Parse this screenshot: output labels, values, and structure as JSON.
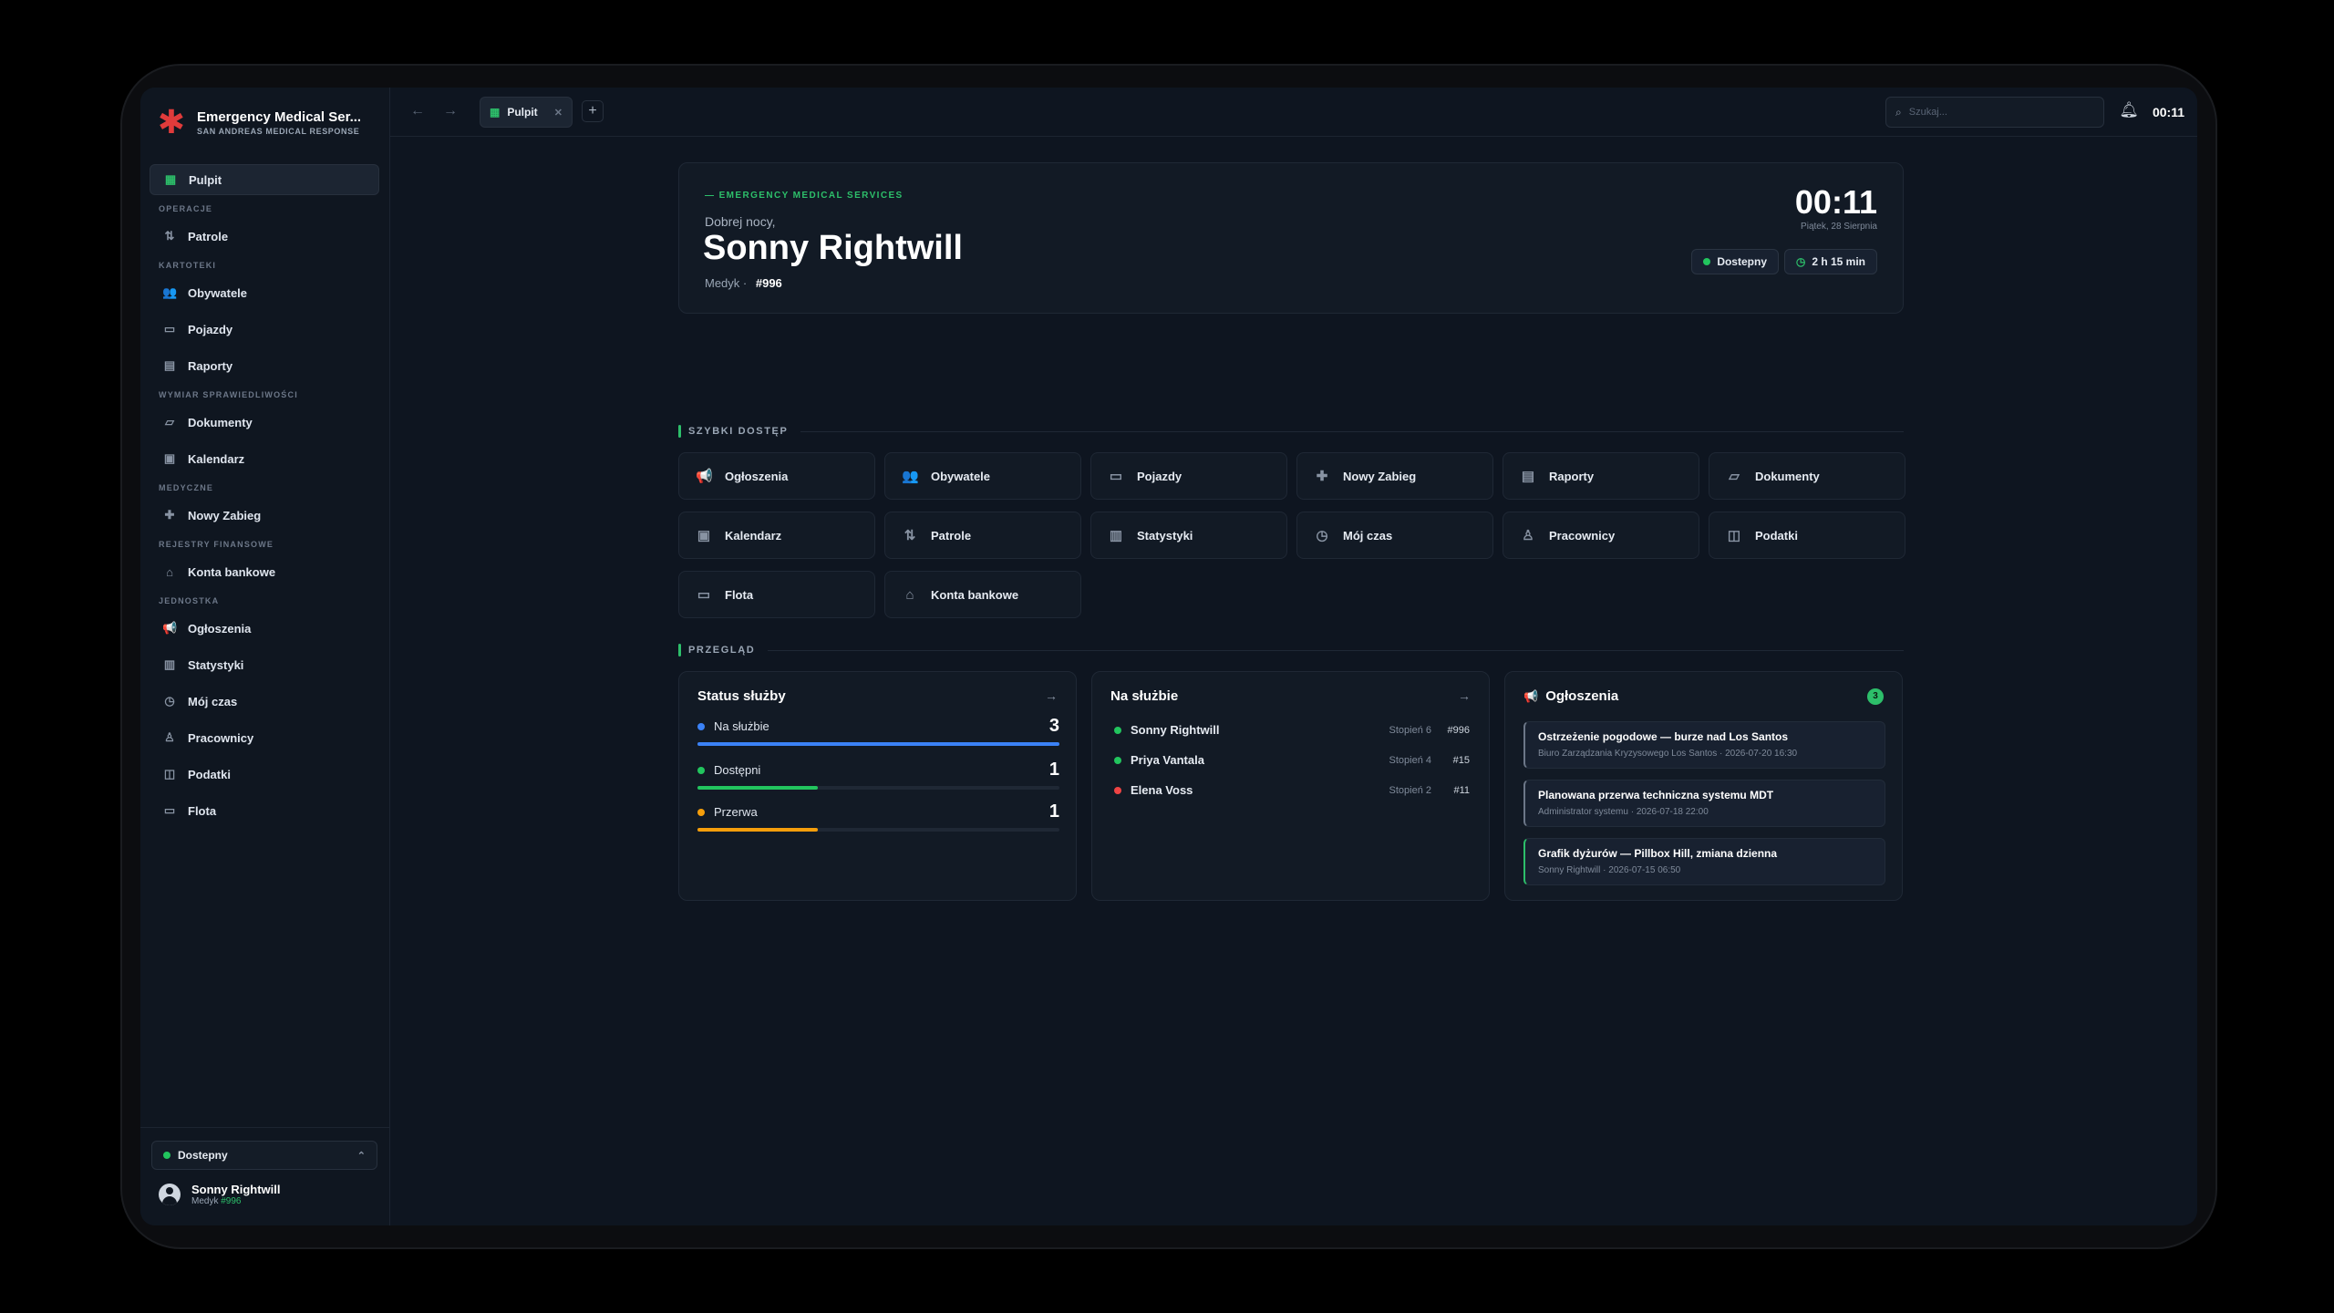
{
  "app": {
    "title": "Emergency Medical Ser...",
    "subtitle": "SAN ANDREAS MEDICAL RESPONSE"
  },
  "sidebar": {
    "active": {
      "label": "Pulpit",
      "icon": "grid-icon"
    },
    "sections": [
      {
        "title": "OPERACJE",
        "items": [
          {
            "label": "Patrole",
            "icon": "route-icon"
          }
        ]
      },
      {
        "title": "KARTOTEKI",
        "items": [
          {
            "label": "Obywatele",
            "icon": "users-icon"
          },
          {
            "label": "Pojazdy",
            "icon": "car-icon"
          },
          {
            "label": "Raporty",
            "icon": "file-icon"
          }
        ]
      },
      {
        "title": "WYMIAR SPRAWIEDLIWOŚCI",
        "items": [
          {
            "label": "Dokumenty",
            "icon": "folder-icon"
          },
          {
            "label": "Kalendarz",
            "icon": "calendar-icon"
          }
        ]
      },
      {
        "title": "MEDYCZNE",
        "items": [
          {
            "label": "Nowy Zabieg",
            "icon": "medkit-icon"
          }
        ]
      },
      {
        "title": "REJESTRY FINANSOWE",
        "items": [
          {
            "label": "Konta bankowe",
            "icon": "bank-icon"
          }
        ]
      },
      {
        "title": "JEDNOSTKA",
        "items": [
          {
            "label": "Ogłoszenia",
            "icon": "megaphone-icon"
          },
          {
            "label": "Statystyki",
            "icon": "chart-icon"
          },
          {
            "label": "Mój czas",
            "icon": "clock-icon"
          },
          {
            "label": "Pracownicy",
            "icon": "worker-icon"
          },
          {
            "label": "Podatki",
            "icon": "money-icon"
          },
          {
            "label": "Flota",
            "icon": "fleet-icon"
          }
        ]
      }
    ],
    "status_label": "Dostepny",
    "user": {
      "name": "Sonny Rightwill",
      "role": "Medyk",
      "badge": "#996"
    }
  },
  "topbar": {
    "tab_label": "Pulpit",
    "search_placeholder": "Szukaj...",
    "clock": "00:11"
  },
  "hero": {
    "tag": "EMERGENCY MEDICAL SERVICES",
    "greeting": "Dobrej nocy,",
    "name": "Sonny Rightwill",
    "role": "Medyk",
    "badge": "#996",
    "clock": "00:11",
    "date": "Piątek, 28 Sierpnia",
    "status": "Dostepny",
    "duration": "2 h 15 min"
  },
  "quick": {
    "title": "SZYBKI DOSTĘP",
    "items": [
      {
        "label": "Ogłoszenia",
        "icon": "megaphone-icon"
      },
      {
        "label": "Obywatele",
        "icon": "users-icon"
      },
      {
        "label": "Pojazdy",
        "icon": "car-icon"
      },
      {
        "label": "Nowy Zabieg",
        "icon": "medkit-icon"
      },
      {
        "label": "Raporty",
        "icon": "file-icon"
      },
      {
        "label": "Dokumenty",
        "icon": "folder-icon"
      },
      {
        "label": "Kalendarz",
        "icon": "calendar-icon"
      },
      {
        "label": "Patrole",
        "icon": "route-icon"
      },
      {
        "label": "Statystyki",
        "icon": "chart-icon"
      },
      {
        "label": "Mój czas",
        "icon": "clock-icon"
      },
      {
        "label": "Pracownicy",
        "icon": "worker-icon"
      },
      {
        "label": "Podatki",
        "icon": "money-icon"
      },
      {
        "label": "Flota",
        "icon": "fleet-icon"
      },
      {
        "label": "Konta bankowe",
        "icon": "bank-icon"
      }
    ]
  },
  "overview": {
    "title": "PRZEGLĄD",
    "status_card": {
      "title": "Status służby",
      "rows": [
        {
          "label": "Na służbie",
          "value": "3",
          "fraction": 1.0,
          "color": "#3b82f6"
        },
        {
          "label": "Dostępni",
          "value": "1",
          "fraction": 0.333,
          "color": "#22c55e"
        },
        {
          "label": "Przerwa",
          "value": "1",
          "fraction": 0.333,
          "color": "#f59e0b"
        }
      ]
    },
    "duty_card": {
      "title": "Na służbie",
      "rows": [
        {
          "name": "Sonny Rightwill",
          "rank": "Stopień 6",
          "badge": "#996",
          "color": "#22c55e"
        },
        {
          "name": "Priya Vantala",
          "rank": "Stopień 4",
          "badge": "#15",
          "color": "#22c55e"
        },
        {
          "name": "Elena Voss",
          "rank": "Stopień 2",
          "badge": "#11",
          "color": "#ef4444"
        }
      ]
    },
    "ann_card": {
      "title": "Ogłoszenia",
      "count": "3",
      "items": [
        {
          "title": "Ostrzeżenie pogodowe — burze nad Los Santos",
          "author": "Biuro Zarządzania Kryzysowego Los Santos",
          "date": "2026-07-20 16:30"
        },
        {
          "title": "Planowana przerwa techniczna systemu MDT",
          "author": "Administrator systemu",
          "date": "2026-07-18 22:00"
        },
        {
          "title": "Grafik dyżurów — Pillbox Hill, zmiana dzienna",
          "author": "Sonny Rightwill",
          "date": "2026-07-15 06:50"
        }
      ]
    }
  }
}
